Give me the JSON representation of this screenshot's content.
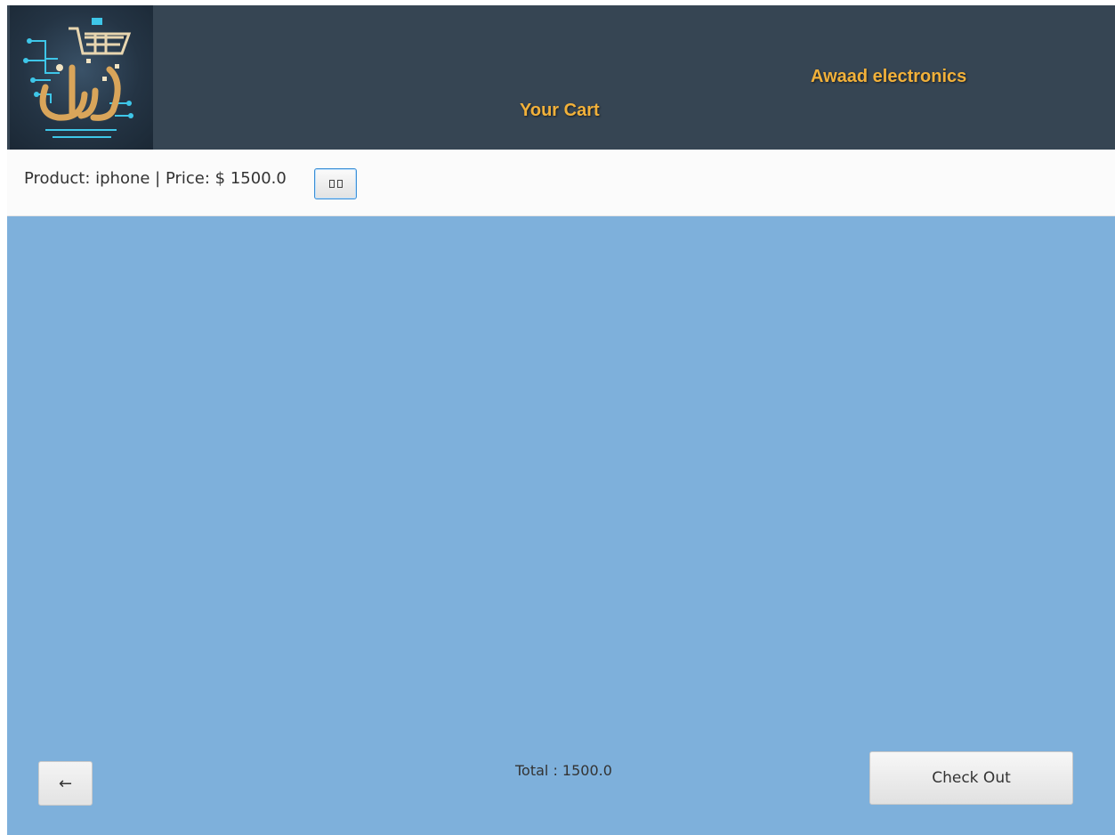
{
  "header": {
    "title": "Your Cart",
    "store_name": "Awaad electronics",
    "logo_icon": "shopping-cart-circuit-logo",
    "accent_color": "#f2b13a",
    "background_color": "#364553"
  },
  "cart": {
    "items": [
      {
        "label": "Product: iphone | Price: $ 1500.0",
        "remove_icon": "remove-item-icon"
      }
    ],
    "background_color": "#7eb0db"
  },
  "footer": {
    "back_label": "←",
    "total_label": "Total : 1500.0",
    "checkout_label": "Check Out"
  }
}
